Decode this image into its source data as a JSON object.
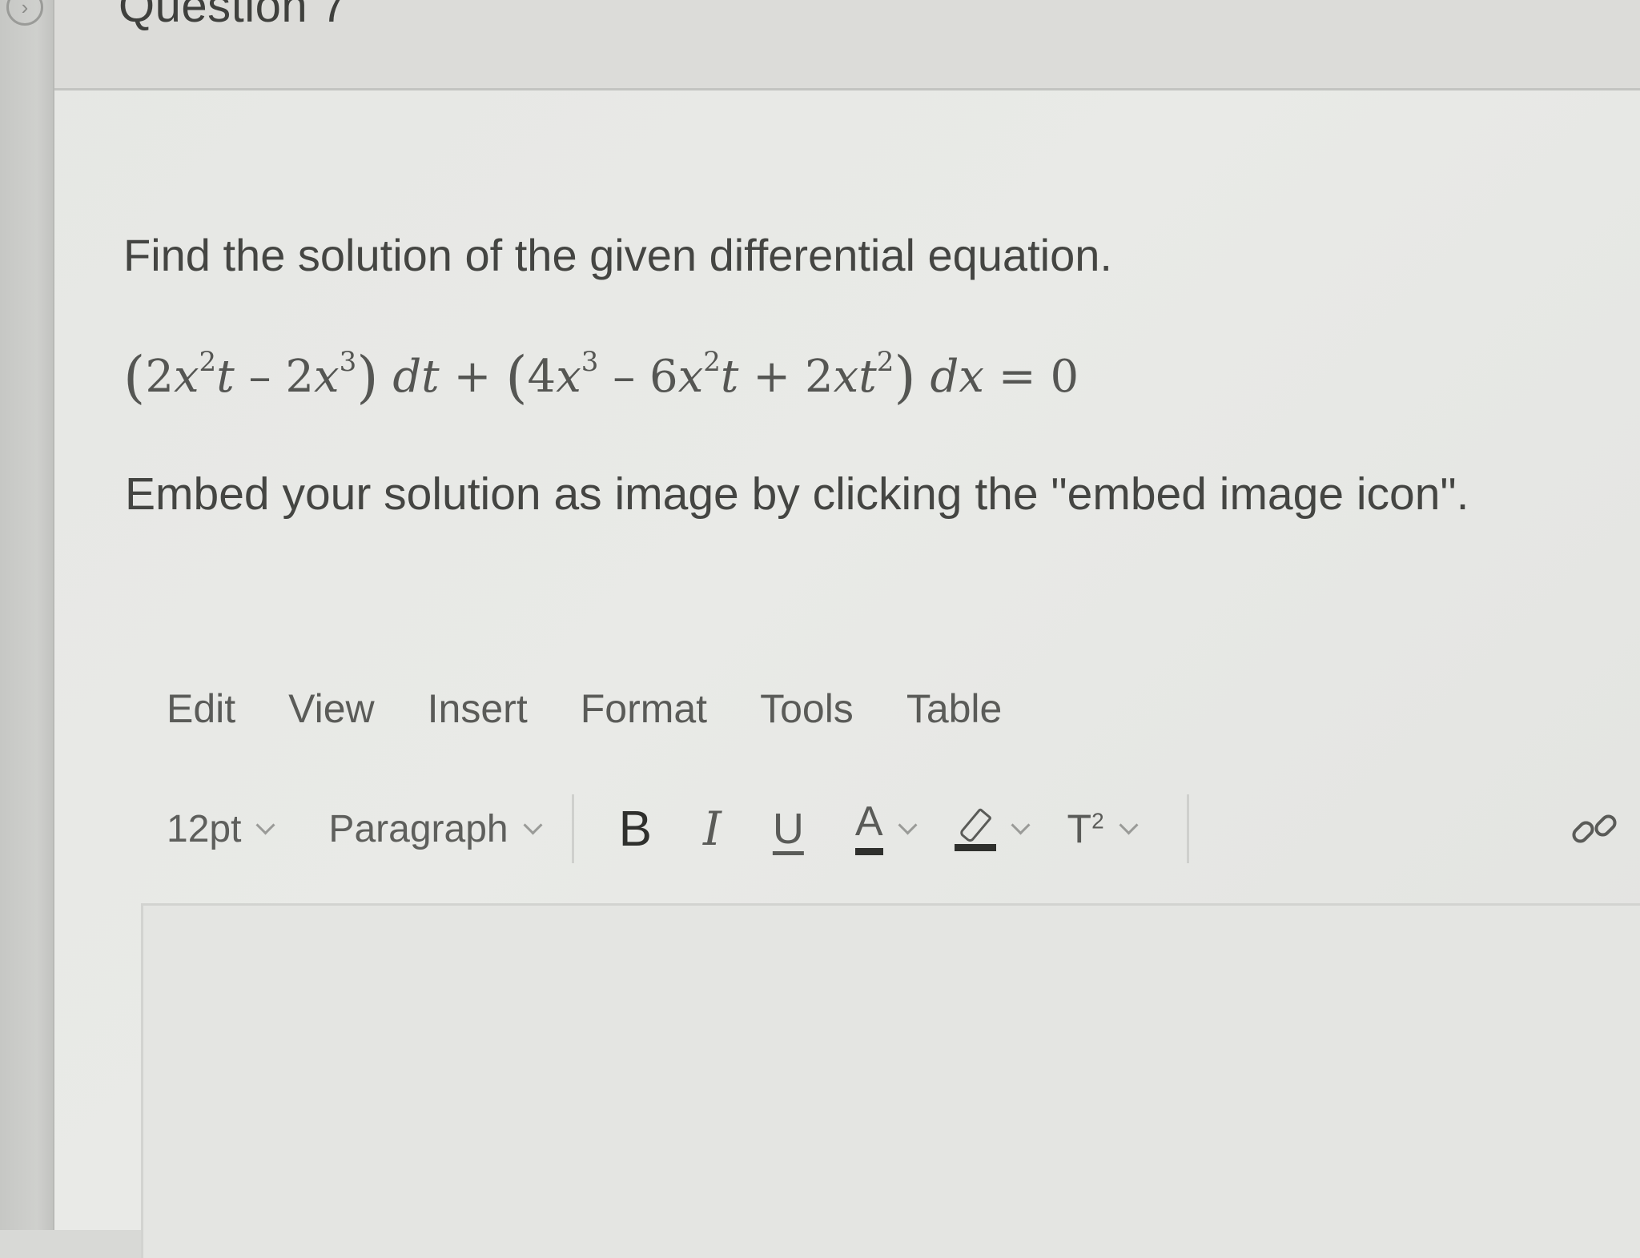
{
  "question": {
    "title": "Question 7",
    "prompt": "Find the solution of the given differential equation.",
    "instruction": "Embed your solution as image by clicking the \"embed image icon\"."
  },
  "equation": {
    "n2a": "2",
    "v_x": "x",
    "e2": "2",
    "v_t": "t",
    "minus": "–",
    "n2b": "2",
    "e3": "3",
    "dt": "dt",
    "plus": "+",
    "n4": "4",
    "n6": "6",
    "plus2": "+",
    "n2c": "2",
    "v_xt": "xt",
    "dx": "dx",
    "equals": "=",
    "zero": "0",
    "open": "(",
    "close": ")"
  },
  "menubar": {
    "edit": "Edit",
    "view": "View",
    "insert": "Insert",
    "format": "Format",
    "tools": "Tools",
    "table": "Table"
  },
  "toolbar": {
    "font_size": "12pt",
    "block_format": "Paragraph",
    "bold": "B",
    "italic": "I",
    "underline": "U",
    "text_color": "A",
    "superscript": "T",
    "superscript_mark": "2"
  },
  "colors": {
    "page_bg": "#e6e7e4",
    "text": "#444542",
    "toolbar_icon": "#5a5b58"
  }
}
